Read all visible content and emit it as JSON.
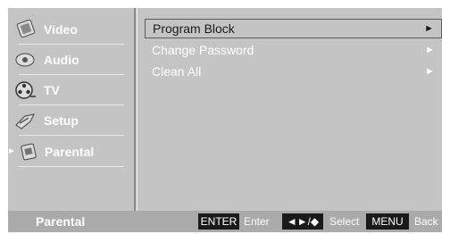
{
  "sidebar": {
    "items": [
      {
        "label": "Video",
        "icon": "video-icon"
      },
      {
        "label": "Audio",
        "icon": "audio-icon"
      },
      {
        "label": "TV",
        "icon": "tv-reel-icon"
      },
      {
        "label": "Setup",
        "icon": "setup-icon"
      },
      {
        "label": "Parental",
        "icon": "parental-icon",
        "active": true
      }
    ],
    "active_marker": "►"
  },
  "menu": {
    "items": [
      {
        "label": "Program Block",
        "arrow": "►",
        "selected": true
      },
      {
        "label": "Change Password",
        "arrow": "►"
      },
      {
        "label": "Clean All",
        "arrow": "►"
      }
    ]
  },
  "footer": {
    "title": "Parental",
    "enter_key": "ENTER",
    "enter_hint": "Enter",
    "nav_key": "◄►/◆",
    "select_hint": "Select",
    "menu_key": "MENU",
    "back_hint": "Back"
  },
  "colors": {
    "panel": "#c4c4c4",
    "footer": "#aaaaaa",
    "key": "#1a1a1a"
  }
}
